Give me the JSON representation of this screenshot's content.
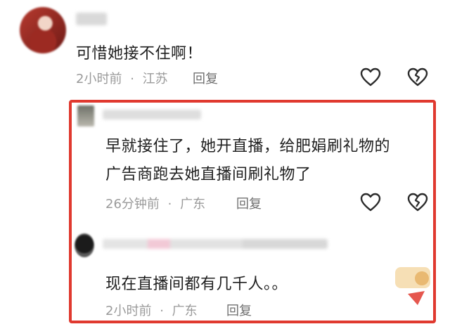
{
  "comments": [
    {
      "text": "可惜她接不住啊！",
      "time": "2小时前",
      "location": "江苏",
      "reply_label": "回复",
      "avatar_color": "#a8322a"
    },
    {
      "text_line1": "早就接住了，她开直播，给肥娟刷礼物的",
      "text_line2": "广告商跑去她直播间刷礼物了",
      "time": "26分钟前",
      "location": "广东",
      "reply_label": "回复"
    },
    {
      "text": "现在直播间都有几千人。。",
      "time": "2小时前",
      "location": "广东",
      "reply_label": "回复"
    }
  ],
  "separator": "·",
  "highlight_color": "#e0392f",
  "icons": [
    "heart-icon",
    "broken-heart-icon"
  ]
}
